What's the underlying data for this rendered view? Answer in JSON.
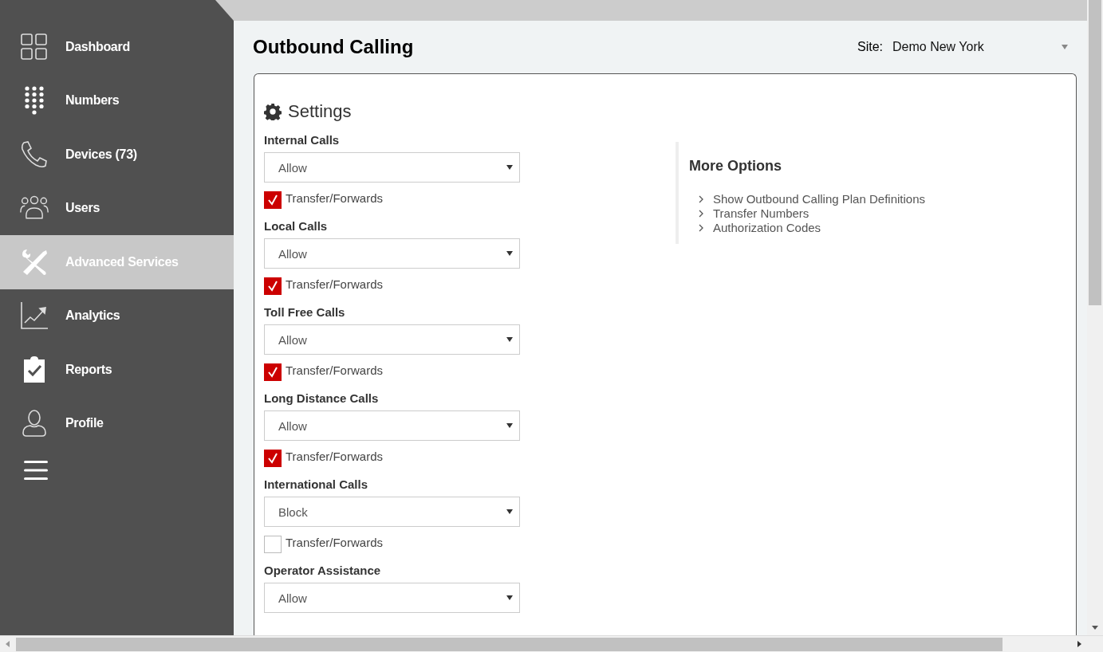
{
  "sidebar": {
    "items": [
      {
        "label": "Dashboard",
        "selected": false
      },
      {
        "label": "Numbers",
        "selected": false
      },
      {
        "label": "Devices (73)",
        "selected": false
      },
      {
        "label": "Users",
        "selected": false
      },
      {
        "label": "Advanced Services",
        "selected": true
      },
      {
        "label": "Analytics",
        "selected": false
      },
      {
        "label": "Reports",
        "selected": false
      },
      {
        "label": "Profile",
        "selected": false
      }
    ]
  },
  "page": {
    "title": "Outbound Calling",
    "site_label": "Site:",
    "site_value": "Demo New York"
  },
  "settings": {
    "title": "Settings",
    "groups": [
      {
        "label": "Internal Calls",
        "value": "Allow",
        "checkbox_label": "Transfer/Forwards",
        "checked": true
      },
      {
        "label": "Local Calls",
        "value": "Allow",
        "checkbox_label": "Transfer/Forwards",
        "checked": true
      },
      {
        "label": "Toll Free Calls",
        "value": "Allow",
        "checkbox_label": "Transfer/Forwards",
        "checked": true
      },
      {
        "label": "Long Distance Calls",
        "value": "Allow",
        "checkbox_label": "Transfer/Forwards",
        "checked": true
      },
      {
        "label": "International Calls",
        "value": "Block",
        "checkbox_label": "Transfer/Forwards",
        "checked": false
      },
      {
        "label": "Operator Assistance",
        "value": "Allow"
      }
    ]
  },
  "more_options": {
    "title": "More Options",
    "links": [
      "Show Outbound Calling Plan Definitions",
      "Transfer Numbers",
      "Authorization Codes"
    ]
  }
}
